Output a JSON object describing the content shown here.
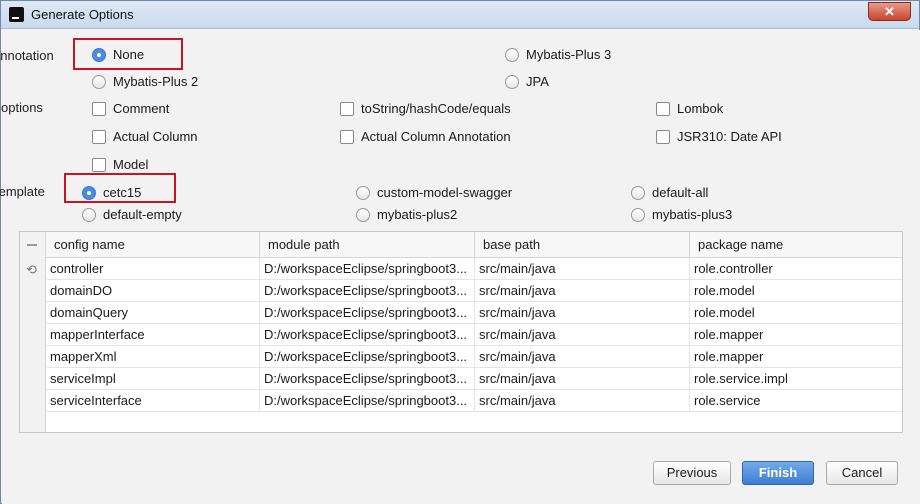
{
  "window": {
    "title": "Generate Options",
    "close_glyph": "✕"
  },
  "annotation": {
    "label": "annotation",
    "options": [
      {
        "label": "None",
        "selected": true
      },
      {
        "label": "Mybatis-Plus 3",
        "selected": false
      },
      {
        "label": "Mybatis-Plus 2",
        "selected": false
      },
      {
        "label": "JPA",
        "selected": false
      }
    ]
  },
  "options": {
    "label": "options",
    "items": [
      {
        "label": "Comment",
        "checked": false
      },
      {
        "label": "toString/hashCode/equals",
        "checked": false
      },
      {
        "label": "Lombok",
        "checked": false
      },
      {
        "label": "Actual Column",
        "checked": false
      },
      {
        "label": "Actual Column Annotation",
        "checked": false
      },
      {
        "label": "JSR310: Date API",
        "checked": false
      },
      {
        "label": "Model",
        "checked": false
      }
    ]
  },
  "template": {
    "label": "template",
    "options": [
      {
        "label": "cetc15",
        "selected": true
      },
      {
        "label": "custom-model-swagger",
        "selected": false
      },
      {
        "label": "default-all",
        "selected": false
      },
      {
        "label": "default-empty",
        "selected": false
      },
      {
        "label": "mybatis-plus2",
        "selected": false
      },
      {
        "label": "mybatis-plus3",
        "selected": false
      }
    ]
  },
  "table": {
    "columns": [
      "config name",
      "module path",
      "base path",
      "package name"
    ],
    "rows": [
      [
        "controller",
        "D:/workspaceEclipse/springboot3...",
        "src/main/java",
        "role.controller"
      ],
      [
        "domainDO",
        "D:/workspaceEclipse/springboot3...",
        "src/main/java",
        "role.model"
      ],
      [
        "domainQuery",
        "D:/workspaceEclipse/springboot3...",
        "src/main/java",
        "role.model"
      ],
      [
        "mapperInterface",
        "D:/workspaceEclipse/springboot3...",
        "src/main/java",
        "role.mapper"
      ],
      [
        "mapperXml",
        "D:/workspaceEclipse/springboot3...",
        "src/main/java",
        "role.mapper"
      ],
      [
        "serviceImpl",
        "D:/workspaceEclipse/springboot3...",
        "src/main/java",
        "role.service.impl"
      ],
      [
        "serviceInterface",
        "D:/workspaceEclipse/springboot3...",
        "src/main/java",
        "role.service"
      ]
    ],
    "toolbar": {
      "remove_icon": "minus-icon",
      "refresh_icon": "refresh-icon",
      "refresh_glyph": "⟲"
    }
  },
  "buttons": {
    "previous": "Previous",
    "finish": "Finish",
    "cancel": "Cancel"
  },
  "colors": {
    "highlight_box": "#c8141e",
    "radio_selected": "#4a8ce3",
    "primary_button": "#3f7fd1"
  }
}
